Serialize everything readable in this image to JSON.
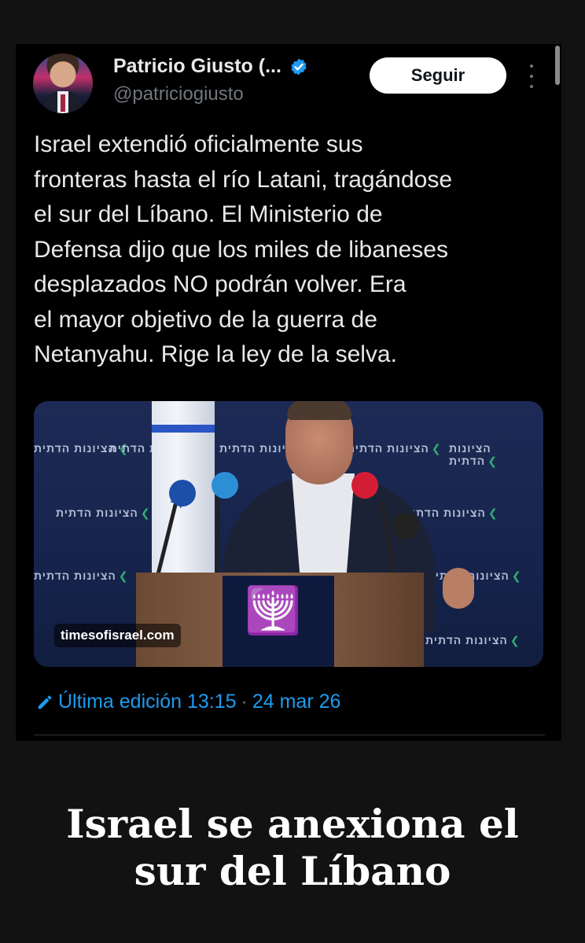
{
  "tweet": {
    "author": {
      "display_name": "Patricio Giusto (...",
      "handle": "@patriciogiusto",
      "verified": true
    },
    "follow_label": "Seguir",
    "text_lines": [
      "Israel extendió oficialmente sus",
      "fronteras hasta el río Latani, tragándose",
      "el sur del Líbano. El Ministerio de",
      "Defensa dijo que los miles de libaneses",
      "desplazados NO podrán volver. Era",
      "el mayor objetivo de la guerra de",
      "Netanyahu. Rige la ley de la selva."
    ],
    "media": {
      "watermark": "timesofisrael.com",
      "backdrop_logo_text": "הציונות הדתית"
    },
    "edit_info": {
      "label": "Última edición 13:15",
      "separator": "·",
      "date": "24 mar 26"
    }
  },
  "caption": {
    "lines": [
      "Israel se anexiona el",
      "sur del Líbano"
    ]
  },
  "colors": {
    "page_background": "#121212",
    "card_background": "#000000",
    "text_primary": "#e7e9ea",
    "text_secondary": "#71767b",
    "link_blue": "#1d9bf0",
    "verified_blue": "#1d9bf0",
    "follow_button_bg": "#ffffff"
  },
  "icons": {
    "verified": "verified-badge-icon",
    "more": "more-vertical-icon",
    "edit": "pencil-icon"
  }
}
